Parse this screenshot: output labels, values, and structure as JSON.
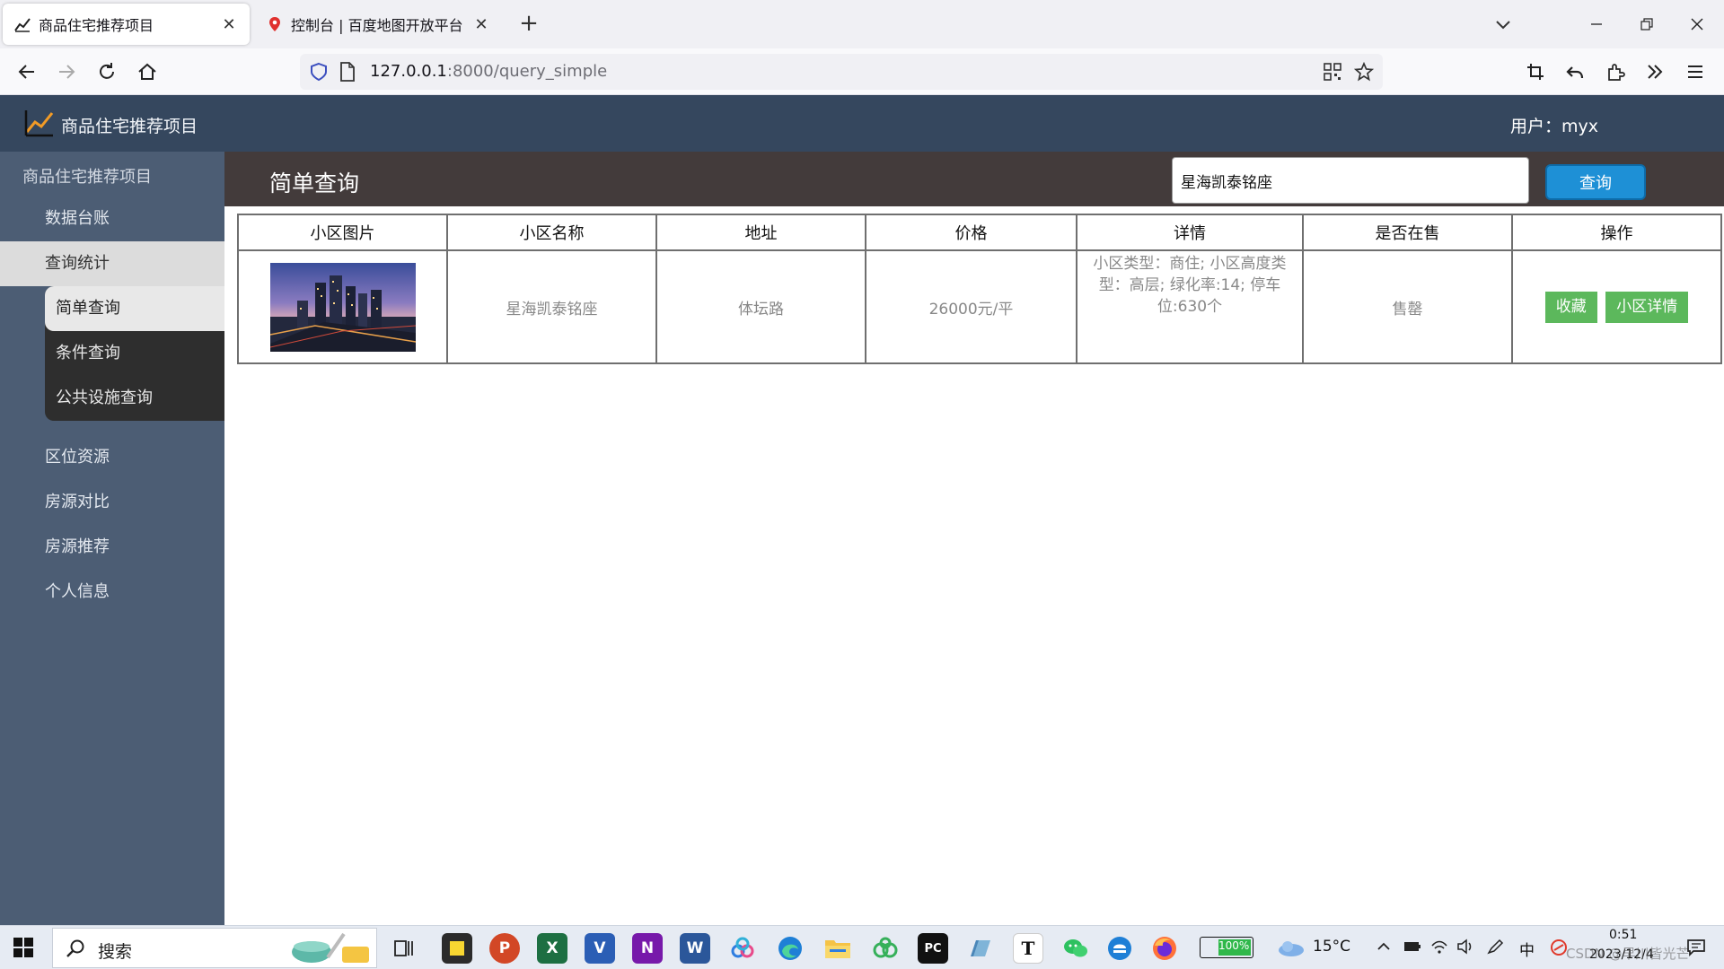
{
  "browser": {
    "tabs": [
      {
        "title": "商品住宅推荐项目",
        "active": true
      },
      {
        "title": "控制台 | 百度地图开放平台",
        "active": false
      }
    ],
    "url_host": "127.0.0.1",
    "url_path": ":8000/query_simple"
  },
  "header": {
    "app_title": "商品住宅推荐项目",
    "user_label": "用户：myx"
  },
  "sidebar": {
    "root_label": "商品住宅推荐项目",
    "items": [
      {
        "label": "数据台账"
      },
      {
        "label": "查询统计"
      },
      {
        "label": "区位资源"
      },
      {
        "label": "房源对比"
      },
      {
        "label": "房源推荐"
      },
      {
        "label": "个人信息"
      }
    ],
    "subitems": [
      {
        "label": "简单查询"
      },
      {
        "label": "条件查询"
      },
      {
        "label": "公共设施查询"
      }
    ]
  },
  "main": {
    "page_title": "简单查询",
    "search_value": "星海凯泰铭座",
    "query_button": "查询",
    "columns": [
      "小区图片",
      "小区名称",
      "地址",
      "价格",
      "详情",
      "是否在售",
      "操作"
    ],
    "rows": [
      {
        "name": "星海凯泰铭座",
        "address": "体坛路",
        "price": "26000元/平",
        "details": "小区类型：商住; 小区高度类型：高层; 绿化率:14; 停车位:630个",
        "on_sale": "售罄",
        "action_favorite": "收藏",
        "action_detail": "小区详情"
      }
    ]
  },
  "taskbar": {
    "search_label": "搜索",
    "battery": "100%",
    "weather": "15°C",
    "ime": "中",
    "time": "0:51",
    "date": "2023/12/4",
    "watermark": "CSDN @早川皆光芒"
  }
}
